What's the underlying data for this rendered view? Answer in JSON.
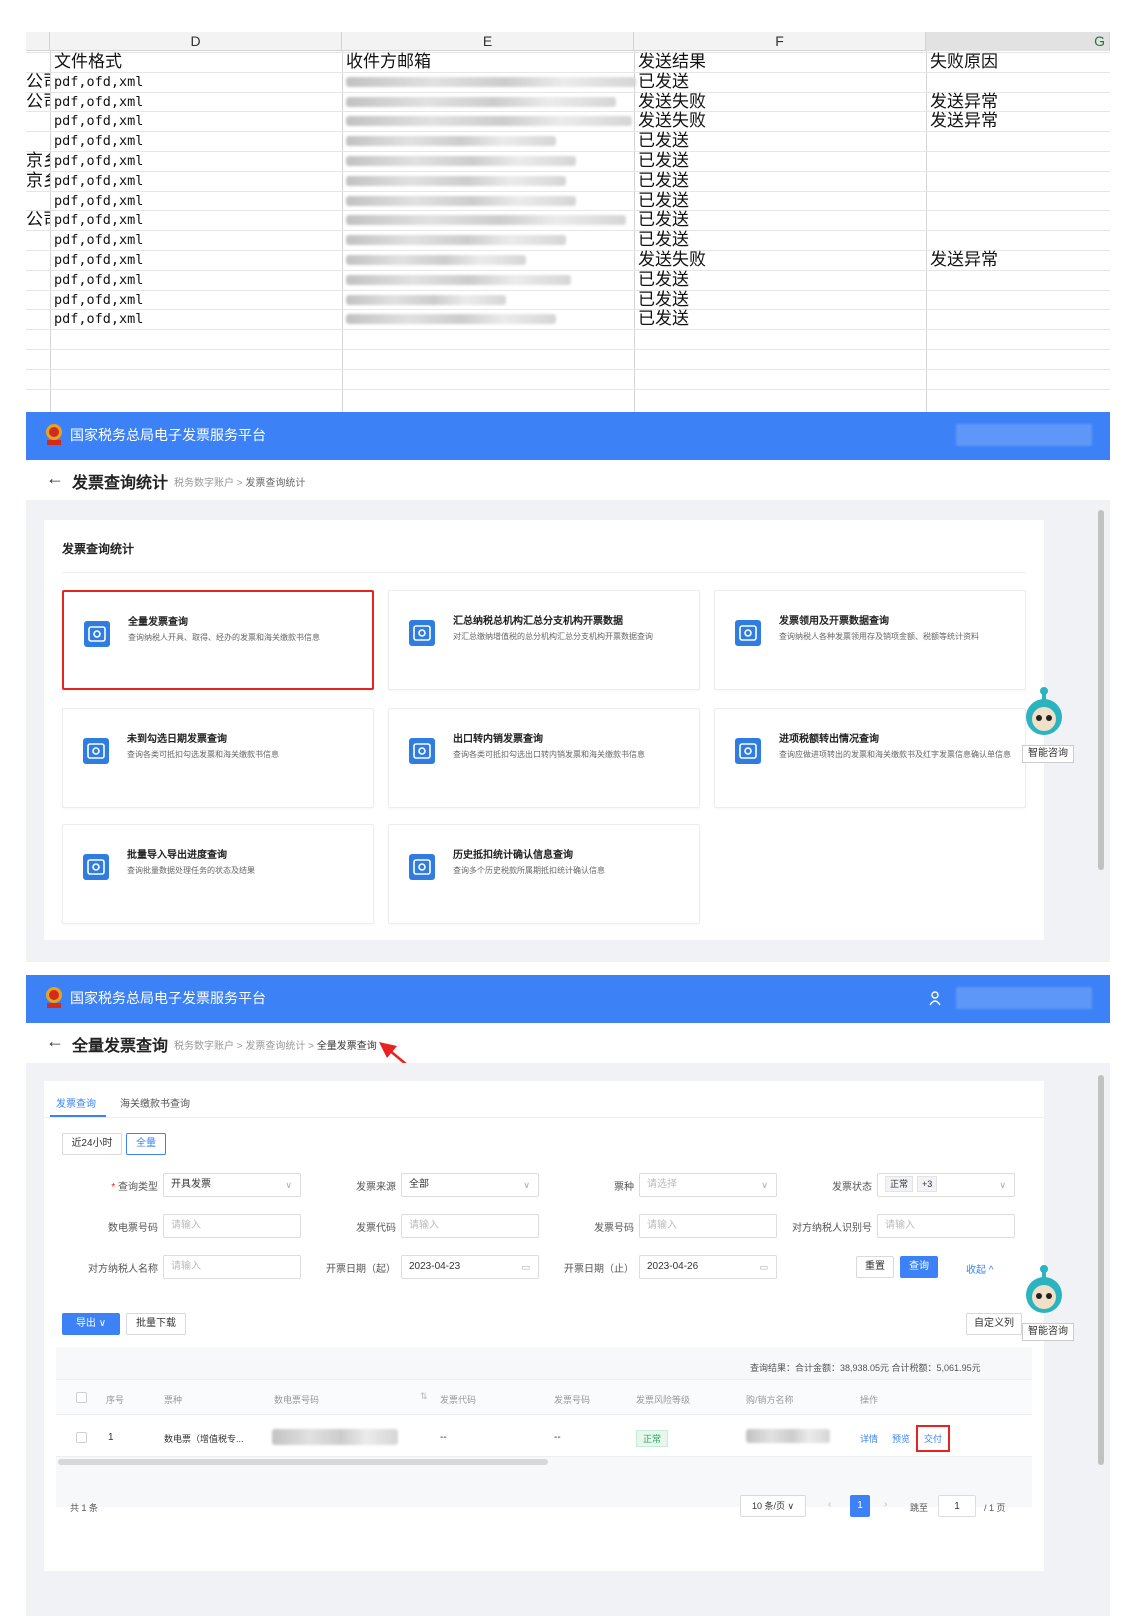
{
  "sheet": {
    "columns": [
      "D",
      "E",
      "F",
      "G"
    ],
    "headers": {
      "format": "文件格式",
      "email": "收件方邮箱",
      "result": "发送结果",
      "reason": "失败原因"
    },
    "rows": [
      {
        "prefix": "公司",
        "format": "pdf,ofd,xml",
        "result": "已发送",
        "reason": ""
      },
      {
        "prefix": "公司",
        "format": "pdf,ofd,xml",
        "result": "发送失败",
        "reason": "发送异常"
      },
      {
        "prefix": "",
        "format": "pdf,ofd,xml",
        "result": "发送失败",
        "reason": "发送异常"
      },
      {
        "prefix": "",
        "format": "pdf,ofd,xml",
        "result": "已发送",
        "reason": ""
      },
      {
        "prefix": "京乡",
        "format": "pdf,ofd,xml",
        "result": "已发送",
        "reason": ""
      },
      {
        "prefix": "京乡",
        "format": "pdf,ofd,xml",
        "result": "已发送",
        "reason": ""
      },
      {
        "prefix": "",
        "format": "pdf,ofd,xml",
        "result": "已发送",
        "reason": ""
      },
      {
        "prefix": "公司",
        "format": "pdf,ofd,xml",
        "result": "已发送",
        "reason": ""
      },
      {
        "prefix": "",
        "format": "pdf,ofd,xml",
        "result": "已发送",
        "reason": ""
      },
      {
        "prefix": "",
        "format": "pdf,ofd,xml",
        "result": "发送失败",
        "reason": "发送异常"
      },
      {
        "prefix": "",
        "format": "pdf,ofd,xml",
        "result": "已发送",
        "reason": ""
      },
      {
        "prefix": "",
        "format": "pdf,ofd,xml",
        "result": "已发送",
        "reason": ""
      },
      {
        "prefix": "",
        "format": "pdf,ofd,xml",
        "result": "已发送",
        "reason": ""
      }
    ]
  },
  "platform": {
    "title": "国家税务总局电子发票服务平台"
  },
  "chatbot": {
    "label": "智能咨询"
  },
  "screen1": {
    "page_title": "发票查询统计",
    "breadcrumb": [
      "税务数字账户",
      "发票查询统计"
    ],
    "section_title": "发票查询统计",
    "tiles": [
      {
        "title": "全量发票查询",
        "desc": "查询纳税人开具、取得、经办的发票和海关缴款书信息"
      },
      {
        "title": "汇总纳税总机构汇总分支机构开票数据",
        "desc": "对汇总缴纳增值税的总分机构汇总分支机构开票数据查询"
      },
      {
        "title": "发票领用及开票数据查询",
        "desc": "查询纳税人各种发票领用存及销项金额、税额等统计资料"
      },
      {
        "title": "未到勾选日期发票查询",
        "desc": "查询各类可抵扣勾选发票和海关缴款书信息"
      },
      {
        "title": "出口转内销发票查询",
        "desc": "查询各类可抵扣勾选出口转内销发票和海关缴款书信息"
      },
      {
        "title": "进项税额转出情况查询",
        "desc": "查询应做进项转出的发票和海关缴款书及红字发票信息确认单信息"
      },
      {
        "title": "批量导入导出进度查询",
        "desc": "查询批量数据处理任务的状态及结果"
      },
      {
        "title": "历史抵扣统计确认信息查询",
        "desc": "查询多个历史税款所属期抵扣统计确认信息"
      }
    ]
  },
  "screen2": {
    "page_title": "全量发票查询",
    "breadcrumb": [
      "税务数字账户",
      "发票查询统计",
      "全量发票查询"
    ],
    "tabs": [
      "发票查询",
      "海关缴款书查询"
    ],
    "range_buttons": [
      "近24小时",
      "全量"
    ],
    "form": {
      "query_type_label": "查询类型",
      "query_type_value": "开具发票",
      "source_label": "发票来源",
      "source_value": "全部",
      "kind_label": "票种",
      "kind_placeholder": "请选择",
      "status_label": "发票状态",
      "status_tag": "正常",
      "status_more": "+3",
      "einvoice_label": "数电票号码",
      "einvoice_placeholder": "请输入",
      "code_label": "发票代码",
      "code_placeholder": "请输入",
      "number_label": "发票号码",
      "number_placeholder": "请输入",
      "taxid_label": "对方纳税人识别号",
      "taxid_placeholder": "请输入",
      "name_label": "对方纳税人名称",
      "name_placeholder": "请输入",
      "date_from_label": "开票日期（起）",
      "date_from_value": "2023-04-23",
      "date_to_label": "开票日期（止）",
      "date_to_value": "2023-04-26",
      "reset_label": "重置",
      "query_label": "查询",
      "collapse_label": "收起 ^"
    },
    "export_label": "导出 ∨",
    "batch_download_label": "批量下载",
    "custom_columns_label": "自定义列",
    "summary": "查询结果：合计金额：38,938.05元  合计税额：5,061.95元",
    "table": {
      "headers": [
        "序号",
        "票种",
        "数电票号码",
        "发票代码",
        "发票号码",
        "发票风险等级",
        "购/销方名称",
        "操作"
      ],
      "row": {
        "index": "1",
        "kind": "数电票（增值税专...",
        "code": "--",
        "number": "--",
        "risk": "正常",
        "actions": [
          "详情",
          "预览",
          "交付"
        ]
      }
    },
    "footer": {
      "total": "共 1 条",
      "page_size": "10 条/页 ∨",
      "page": "1",
      "jump_label": "跳至",
      "jump_value": "1",
      "pages": "/ 1 页"
    }
  }
}
